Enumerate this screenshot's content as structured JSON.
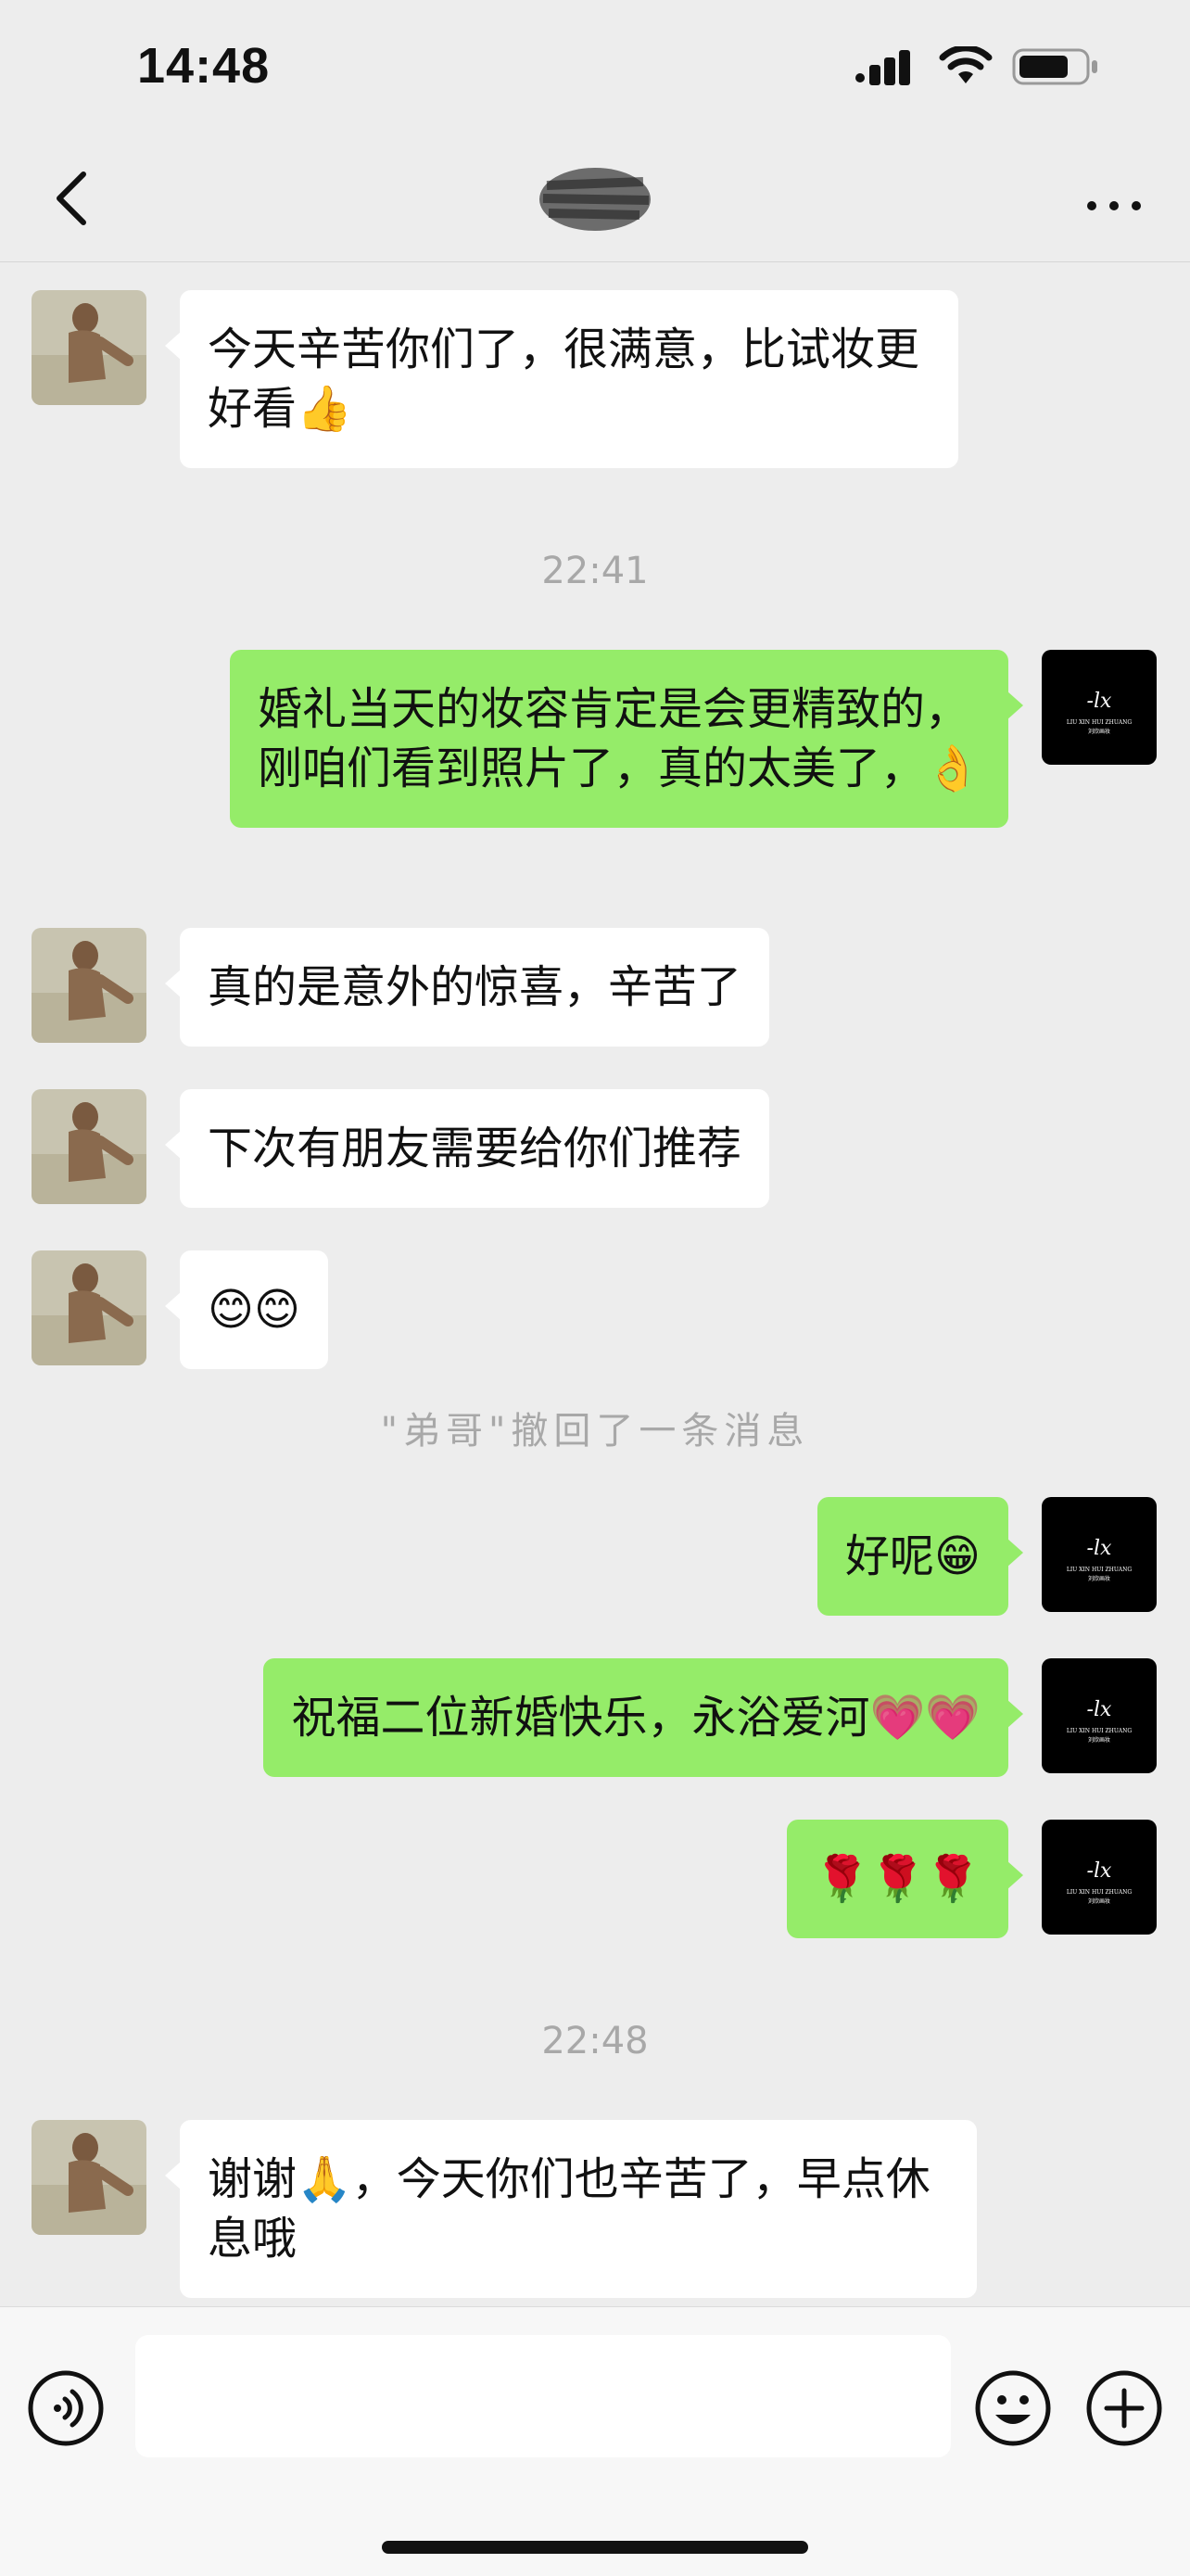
{
  "status_bar": {
    "time": "14:48"
  },
  "nav": {
    "title_redacted": true
  },
  "messages": [
    {
      "side": "peer",
      "text": "今天辛苦你们了，很满意，比试妆更好看👍"
    },
    {
      "timestamp": "22:41"
    },
    {
      "side": "self",
      "text": "婚礼当天的妆容肯定是会更精致的，刚咱们看到照片了，真的太美了，👌"
    },
    {
      "side": "peer",
      "text": "真的是意外的惊喜，辛苦了"
    },
    {
      "side": "peer",
      "text": "下次有朋友需要给你们推荐"
    },
    {
      "side": "peer",
      "text": "😊😊"
    },
    {
      "system": "\"弟哥\"撤回了一条消息"
    },
    {
      "side": "self",
      "text": "好呢😁"
    },
    {
      "side": "self",
      "text": "祝福二位新婚快乐，永浴爱河💗💗"
    },
    {
      "side": "self",
      "text": "🌹🌹🌹"
    },
    {
      "timestamp": "22:48"
    },
    {
      "side": "peer",
      "text": "谢谢🙏，今天你们也辛苦了，早点休息哦"
    }
  ],
  "self_avatar_logo": {
    "mark": "-lx",
    "line1": "LIU XIN HUI ZHUANG",
    "line2": "刘欣画妆"
  },
  "input": {
    "placeholder": ""
  },
  "colors": {
    "self_bubble": "#95ec69",
    "peer_bubble": "#ffffff",
    "background": "#ededed"
  }
}
